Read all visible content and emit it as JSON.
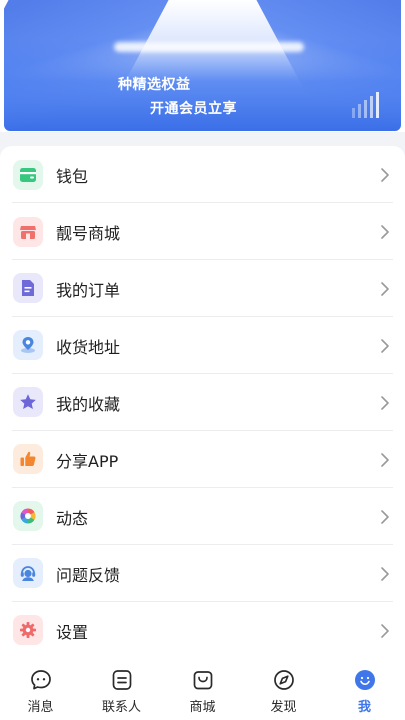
{
  "banner": {
    "line1": "种精选权益",
    "line2": "开通会员立享"
  },
  "menu": {
    "items": [
      {
        "label": "钱包",
        "icon": "wallet-icon",
        "color": "#37c77f",
        "bg": "#e3f7ec"
      },
      {
        "label": "靓号商城",
        "icon": "store-icon",
        "color": "#f0706b",
        "bg": "#fde6e5"
      },
      {
        "label": "我的订单",
        "icon": "order-document-icon",
        "color": "#6e6ad9",
        "bg": "#e9e8fb"
      },
      {
        "label": "收货地址",
        "icon": "location-pin-icon",
        "color": "#4a86e0",
        "bg": "#e4eefc"
      },
      {
        "label": "我的收藏",
        "icon": "star-icon",
        "color": "#6c66d8",
        "bg": "#e9e8fb"
      },
      {
        "label": "分享APP",
        "icon": "thumbs-up-icon",
        "color": "#f4862f",
        "bg": "#fdecdd"
      },
      {
        "label": "动态",
        "icon": "aperture-icon",
        "color": "#3cba7a",
        "bg": "#e3f7ec"
      },
      {
        "label": "问题反馈",
        "icon": "customer-service-icon",
        "color": "#4a86e0",
        "bg": "#e4eefc"
      },
      {
        "label": "设置",
        "icon": "gear-icon",
        "color": "#ef6a6a",
        "bg": "#fde6e5"
      }
    ]
  },
  "bottom_nav": {
    "items": [
      {
        "label": "消息",
        "icon": "message-bubble-icon",
        "active": false
      },
      {
        "label": "联系人",
        "icon": "contacts-icon",
        "active": false
      },
      {
        "label": "商城",
        "icon": "shopping-bag-icon",
        "active": false
      },
      {
        "label": "发现",
        "icon": "compass-icon",
        "active": false
      },
      {
        "label": "我",
        "icon": "smiley-profile-icon",
        "active": true
      }
    ],
    "active_color": "#3f76ea"
  }
}
